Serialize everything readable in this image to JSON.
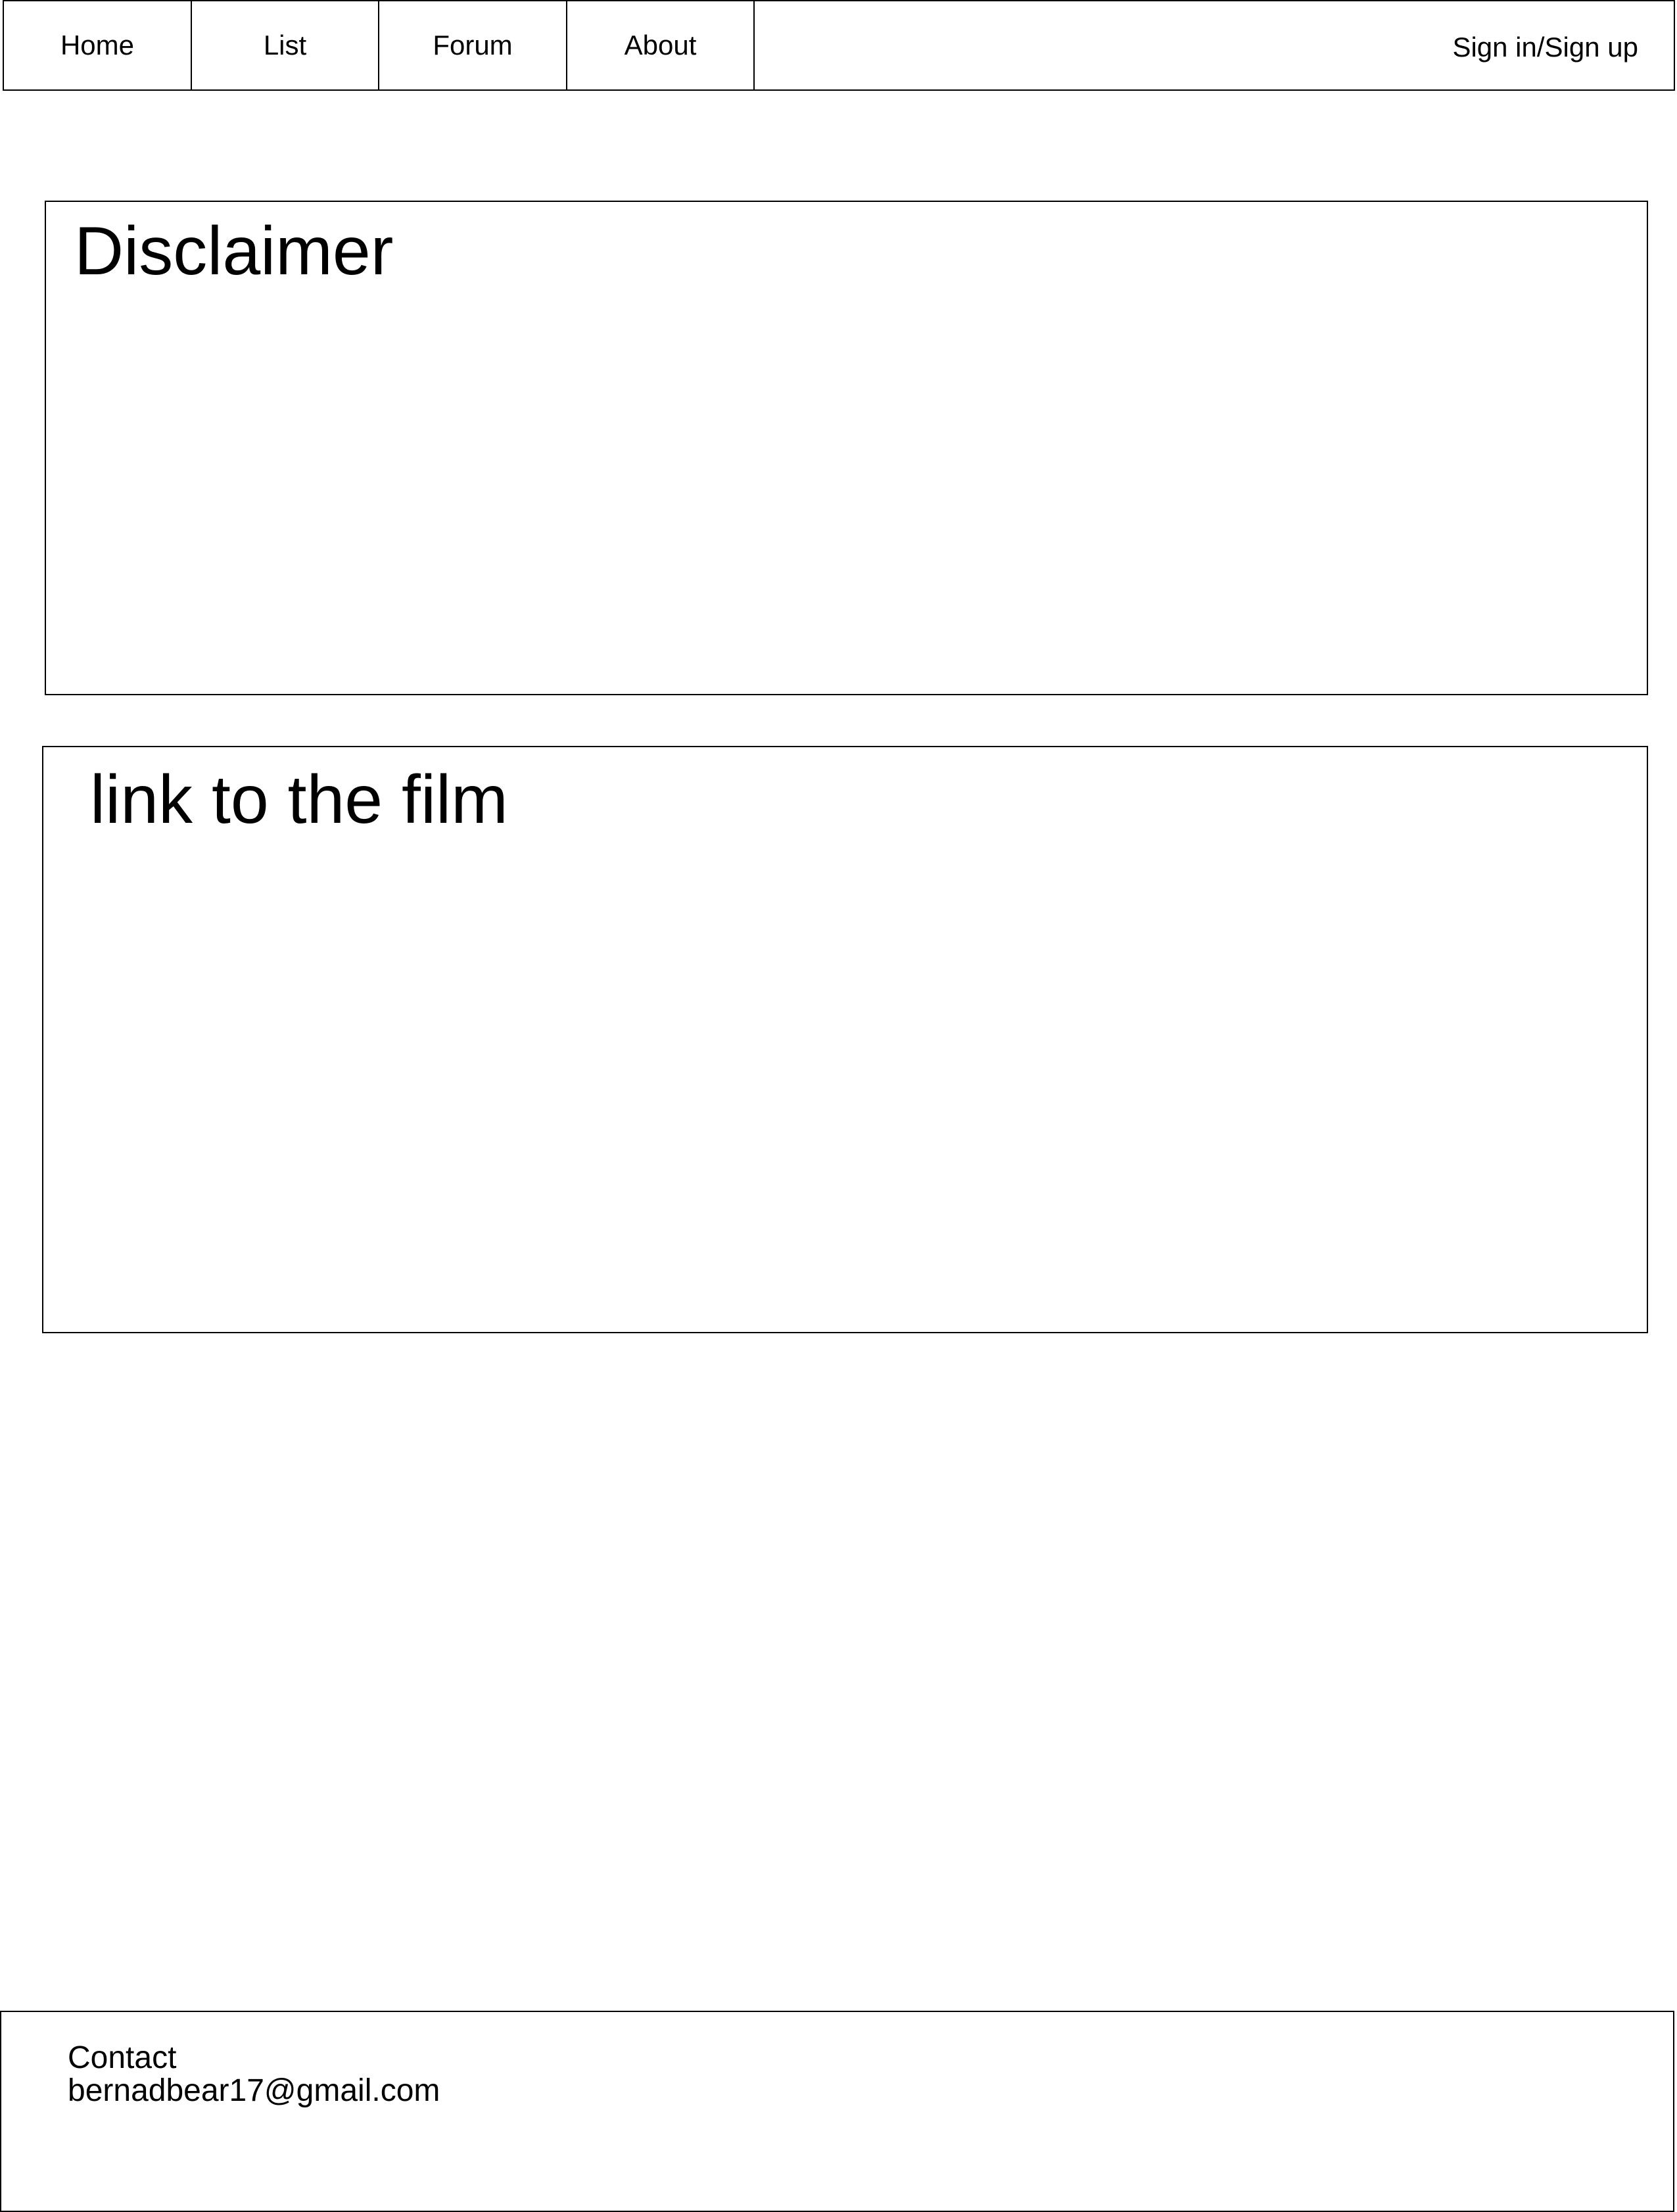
{
  "nav": {
    "items": [
      {
        "label": "Home"
      },
      {
        "label": "List"
      },
      {
        "label": "Forum"
      },
      {
        "label": "About"
      }
    ],
    "signin_label": "Sign in/Sign up"
  },
  "disclaimer": {
    "title": "Disclaimer"
  },
  "film": {
    "title": "link to the film"
  },
  "footer": {
    "contact_label": "Contact",
    "email": "bernadbear17@gmail.com"
  }
}
